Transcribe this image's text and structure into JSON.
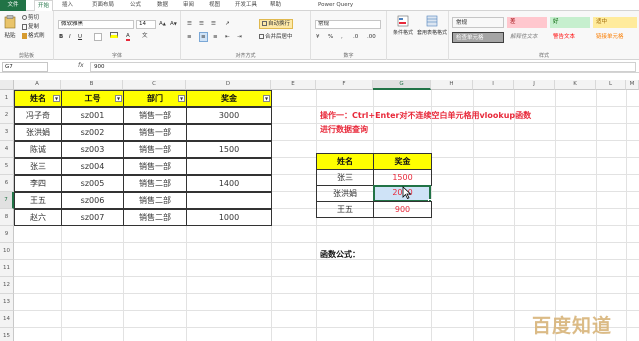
{
  "ribbon_tabs": [
    "文件",
    "开始",
    "插入",
    "页面布局",
    "公式",
    "数据",
    "审阅",
    "视图",
    "开发工具",
    "帮助",
    "Power Query"
  ],
  "ribbon": {
    "paste": "粘贴",
    "cut": "剪切",
    "copy": "复制",
    "format_painter": "格式刷",
    "clipboard": "剪贴板",
    "font_name": "微软雅黑",
    "font_size": "14",
    "font_group": "字体",
    "align_group": "对齐方式",
    "wrap_text": "自动换行",
    "merge_center": "合并后居中",
    "number_format": "常规",
    "number_group": "数字",
    "cond_format": "条件格式",
    "table_format": "套用表格格式",
    "styles_group": "样式",
    "styles": [
      {
        "label": "常规",
        "bg": "#ffffff",
        "color": "#222222"
      },
      {
        "label": "差",
        "bg": "#ffc7ce",
        "color": "#9c0006"
      },
      {
        "label": "好",
        "bg": "#c6efce",
        "color": "#006100"
      },
      {
        "label": "适中",
        "bg": "#ffeb9c",
        "color": "#9c6500"
      },
      {
        "label": "检查单元格",
        "bg": "#a5a5a5",
        "color": "#ffffff"
      },
      {
        "label": "解释性文本",
        "bg": "#ffffff",
        "color": "#7f7f7f"
      },
      {
        "label": "警告文本",
        "bg": "#ffffff",
        "color": "#ff0000"
      },
      {
        "label": "链接单元格",
        "bg": "#ffffff",
        "color": "#fa7d00"
      }
    ]
  },
  "formula_bar": {
    "name_box": "G7",
    "fx": "fx",
    "content": "900"
  },
  "columns": [
    "A",
    "B",
    "C",
    "D",
    "E",
    "F",
    "G",
    "H",
    "I",
    "J",
    "K",
    "L",
    "M"
  ],
  "selected_column": "G",
  "rows": [
    "1",
    "2",
    "3",
    "4",
    "5",
    "6",
    "7",
    "8",
    "9",
    "10",
    "11",
    "12",
    "13",
    "14",
    "15"
  ],
  "selected_row": "7",
  "table1": {
    "headers": [
      "姓名",
      "工号",
      "部门",
      "奖金"
    ],
    "rows": [
      [
        "冯子奇",
        "sz001",
        "销售一部",
        "3000"
      ],
      [
        "张洪娟",
        "sz002",
        "销售一部",
        ""
      ],
      [
        "陈诚",
        "sz003",
        "销售一部",
        "1500"
      ],
      [
        "张三",
        "sz004",
        "销售一部",
        ""
      ],
      [
        "李四",
        "sz005",
        "销售二部",
        "1400"
      ],
      [
        "王五",
        "sz006",
        "销售二部",
        ""
      ],
      [
        "赵六",
        "sz007",
        "销售二部",
        "1000"
      ]
    ]
  },
  "note": {
    "line1": "操作一：Ctrl+Enter对不连续空白单元格用vlookup函数",
    "line2": "进行数据查询"
  },
  "table2": {
    "headers": [
      "姓名",
      "奖金"
    ],
    "rows": [
      [
        "张三",
        "1500"
      ],
      [
        "张洪娟",
        "2000"
      ],
      [
        "王五",
        "900"
      ]
    ]
  },
  "formula_label": "函数公式：",
  "watermark": "百度知道",
  "colors": {
    "accent": "#217346",
    "header_fill": "#ffff00",
    "red_text": "#e8293a"
  }
}
